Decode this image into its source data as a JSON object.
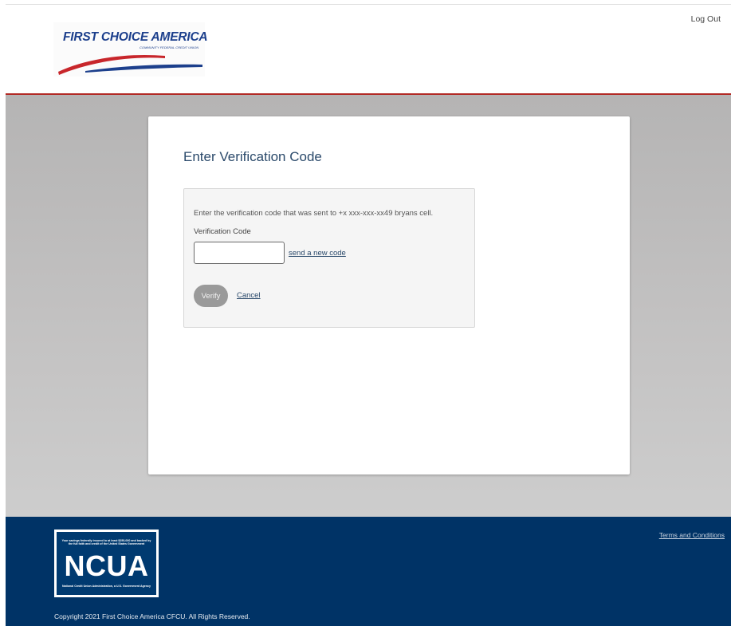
{
  "header": {
    "brand": {
      "name": "FIRST CHOICE AMERICA",
      "tagline": "COMMUNITY FEDERAL CREDIT UNION"
    },
    "logout_label": "Log Out"
  },
  "colors": {
    "accent_red": "#b22a25",
    "brand_navy": "#003366",
    "title_blue": "#2b4a6b",
    "button_gray": "#9a9a9a"
  },
  "card": {
    "title": "Enter Verification Code",
    "message": "Enter the verification code that was sent to +x xxx-xxx-xx49 bryans cell.",
    "field_label": "Verification Code",
    "code_value": "",
    "code_placeholder": "",
    "resend_label": "send a new code",
    "verify_label": "Verify",
    "cancel_label": "Cancel"
  },
  "footer": {
    "ncua": {
      "top_text": "Your savings federally insured to at least $250,000 and backed by the full faith and credit of the United States Government",
      "word": "NCUA",
      "bottom_text": "National Credit Union Administration, a U.S. Government Agency"
    },
    "terms_label": "Terms and Conditions",
    "copyright": "Copyright 2021 First Choice America CFCU. All Rights Reserved."
  }
}
